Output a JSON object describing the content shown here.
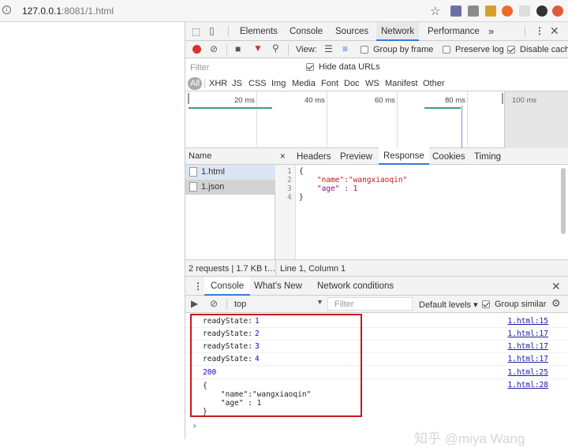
{
  "address_bar": {
    "host": "127.0.0.1",
    "rest": ":8081/1.html"
  },
  "devtools": {
    "main_tabs": [
      "Elements",
      "Console",
      "Sources",
      "Network",
      "Performance",
      "»"
    ],
    "network_toolbar": {
      "view_label": "View:",
      "group_by_frame": "Group by frame",
      "preserve_log": "Preserve log",
      "disable_cache": "Disable cach"
    },
    "filter": {
      "placeholder": "Filter",
      "hide_data_urls": "Hide data URLs",
      "types": [
        "All",
        "XHR",
        "JS",
        "CSS",
        "Img",
        "Media",
        "Font",
        "Doc",
        "WS",
        "Manifest",
        "Other"
      ]
    },
    "timeline": {
      "ticks": [
        "20 ms",
        "40 ms",
        "60 ms",
        "80 ms",
        "100 ms"
      ]
    },
    "requests": {
      "header": "Name",
      "items": [
        "1.html",
        "1.json"
      ],
      "summary": "2 requests | 1.7 KB t…"
    },
    "detail_tabs": [
      "×",
      "Headers",
      "Preview",
      "Response",
      "Cookies",
      "Timing"
    ],
    "response": {
      "line_numbers": [
        "1",
        "2",
        "3",
        "4"
      ],
      "lines": [
        "{",
        "    \"name\":\"wangxiaoqin\"",
        "    \"age\" : 1",
        "}"
      ],
      "cursor": "Line 1, Column 1"
    },
    "drawer_tabs": [
      "Console",
      "What's New",
      "Network conditions"
    ],
    "console_toolbar": {
      "context": "top",
      "filter_placeholder": "Filter",
      "levels": "Default levels ▾",
      "group_similar": "Group similar"
    },
    "console": {
      "rows": [
        {
          "label": "readyState: ",
          "value": "1",
          "source": "1.html:15"
        },
        {
          "label": "readyState: ",
          "value": "2",
          "source": "1.html:17"
        },
        {
          "label": "readyState: ",
          "value": "3",
          "source": "1.html:17"
        },
        {
          "label": "readyState: ",
          "value": "4",
          "source": "1.html:17"
        },
        {
          "label": "",
          "value": "200",
          "source": "1.html:25"
        }
      ],
      "object_lines": [
        "{",
        "    \"name\":\"wangxiaoqin\"",
        "    \"age\" : 1",
        "}"
      ],
      "object_source": "1.html:28",
      "prompt": "›"
    },
    "watermark": "知乎 @miya Wang"
  },
  "colors": {
    "highlight_box": "#c8161d",
    "record_dot": "#d9302c",
    "accent_blue": "#3879d9"
  }
}
